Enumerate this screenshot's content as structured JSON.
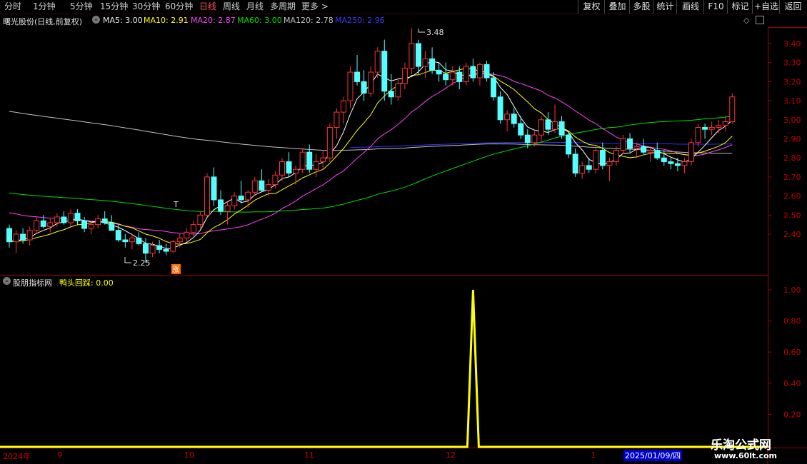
{
  "toolbar": {
    "periods": [
      "分时",
      "1分钟",
      "5分钟",
      "15分钟",
      "30分钟",
      "60分钟",
      "日线",
      "周线",
      "月线",
      "多周期",
      "更多"
    ],
    "active_period": "日线",
    "right_buttons": [
      "复权",
      "叠加",
      "多股",
      "统计",
      "画线",
      "F10",
      "标记",
      "+自选",
      "返回"
    ]
  },
  "legend": {
    "stock_title": "曙光股份(日线,前复权)",
    "ma5": "MA5: 3.00",
    "ma10": "MA10: 2.91",
    "ma20": "MA20: 2.87",
    "ma60": "MA60: 3.00",
    "ma120": "MA120: 2.78",
    "ma250": "MA250: 2.96"
  },
  "indicator_legend": {
    "name": "股朋指标网",
    "value": "鸭头回踩: 0.00"
  },
  "annotations": {
    "high_label": "3.48",
    "low_label": "2.25",
    "surge_marker": "涨",
    "t_marker": "T"
  },
  "price_axis": [
    "3.40",
    "3.30",
    "3.20",
    "3.10",
    "3.00",
    "2.90",
    "2.80",
    "2.70",
    "2.60",
    "2.50",
    "2.40"
  ],
  "indicator_axis": [
    "1.00",
    "0.80",
    "0.60",
    "0.40",
    "0.20"
  ],
  "dates": {
    "year": "2024年",
    "m9": "9",
    "m10": "10",
    "m11": "11",
    "m12": "12",
    "m1": "1",
    "cursor_date": "2025/01/09/四"
  },
  "watermark": {
    "brand": "乐淘公式网",
    "site": "www.60lt.com"
  },
  "colors": {
    "up": "#ff3333",
    "down": "#54ffff",
    "ma5": "#ffffff",
    "ma10": "#ffff00",
    "ma20": "#ff44ff",
    "ma60": "#00e000",
    "ma120": "#c0c0c0",
    "ma250": "#3030ff",
    "indicator": "#ffff00",
    "axis": "#c00000"
  },
  "chart_data": [
    {
      "type": "candlestick",
      "title": "曙光股份(日线,前复权)",
      "y_range": [
        2.2,
        3.5
      ],
      "high": 3.48,
      "low": 2.25,
      "ohlc": [
        [
          2.43,
          2.45,
          2.33,
          2.36
        ],
        [
          2.36,
          2.42,
          2.3,
          2.4
        ],
        [
          2.4,
          2.43,
          2.35,
          2.37
        ],
        [
          2.37,
          2.44,
          2.34,
          2.42
        ],
        [
          2.42,
          2.49,
          2.4,
          2.47
        ],
        [
          2.47,
          2.5,
          2.43,
          2.44
        ],
        [
          2.44,
          2.48,
          2.41,
          2.46
        ],
        [
          2.46,
          2.51,
          2.44,
          2.49
        ],
        [
          2.49,
          2.52,
          2.45,
          2.46
        ],
        [
          2.46,
          2.53,
          2.44,
          2.51
        ],
        [
          2.51,
          2.53,
          2.45,
          2.47
        ],
        [
          2.47,
          2.49,
          2.41,
          2.43
        ],
        [
          2.43,
          2.47,
          2.4,
          2.45
        ],
        [
          2.45,
          2.5,
          2.43,
          2.48
        ],
        [
          2.48,
          2.52,
          2.45,
          2.46
        ],
        [
          2.46,
          2.5,
          2.42,
          2.42
        ],
        [
          2.42,
          2.45,
          2.36,
          2.37
        ],
        [
          2.37,
          2.4,
          2.33,
          2.36
        ],
        [
          2.36,
          2.4,
          2.32,
          2.38
        ],
        [
          2.38,
          2.41,
          2.34,
          2.35
        ],
        [
          2.35,
          2.38,
          2.25,
          2.3
        ],
        [
          2.3,
          2.36,
          2.28,
          2.34
        ],
        [
          2.34,
          2.37,
          2.3,
          2.32
        ],
        [
          2.32,
          2.35,
          2.29,
          2.31
        ],
        [
          2.31,
          2.37,
          2.3,
          2.36
        ],
        [
          2.36,
          2.4,
          2.33,
          2.38
        ],
        [
          2.38,
          2.43,
          2.36,
          2.41
        ],
        [
          2.41,
          2.47,
          2.39,
          2.45
        ],
        [
          2.45,
          2.52,
          2.43,
          2.5
        ],
        [
          2.5,
          2.72,
          2.49,
          2.7
        ],
        [
          2.7,
          2.75,
          2.55,
          2.58
        ],
        [
          2.58,
          2.63,
          2.5,
          2.52
        ],
        [
          2.52,
          2.57,
          2.45,
          2.55
        ],
        [
          2.55,
          2.62,
          2.53,
          2.6
        ],
        [
          2.6,
          2.68,
          2.56,
          2.58
        ],
        [
          2.58,
          2.63,
          2.54,
          2.62
        ],
        [
          2.62,
          2.7,
          2.6,
          2.68
        ],
        [
          2.68,
          2.74,
          2.62,
          2.63
        ],
        [
          2.63,
          2.69,
          2.6,
          2.66
        ],
        [
          2.66,
          2.73,
          2.64,
          2.71
        ],
        [
          2.71,
          2.8,
          2.68,
          2.78
        ],
        [
          2.78,
          2.83,
          2.7,
          2.72
        ],
        [
          2.72,
          2.76,
          2.66,
          2.74
        ],
        [
          2.74,
          2.85,
          2.72,
          2.83
        ],
        [
          2.83,
          2.87,
          2.72,
          2.74
        ],
        [
          2.74,
          2.82,
          2.7,
          2.78
        ],
        [
          2.78,
          2.84,
          2.74,
          2.8
        ],
        [
          2.8,
          2.98,
          2.78,
          2.96
        ],
        [
          2.96,
          3.06,
          2.9,
          3.04
        ],
        [
          3.04,
          3.12,
          2.98,
          3.1
        ],
        [
          3.1,
          3.28,
          3.06,
          3.25
        ],
        [
          3.25,
          3.34,
          3.18,
          3.2
        ],
        [
          3.2,
          3.26,
          3.1,
          3.14
        ],
        [
          3.14,
          3.28,
          3.12,
          3.25
        ],
        [
          3.25,
          3.38,
          3.22,
          3.36
        ],
        [
          3.36,
          3.42,
          3.1,
          3.15
        ],
        [
          3.15,
          3.24,
          3.08,
          3.12
        ],
        [
          3.12,
          3.22,
          3.1,
          3.19
        ],
        [
          3.19,
          3.3,
          3.16,
          3.27
        ],
        [
          3.27,
          3.48,
          3.24,
          3.4
        ],
        [
          3.4,
          3.42,
          3.24,
          3.28
        ],
        [
          3.28,
          3.36,
          3.22,
          3.32
        ],
        [
          3.32,
          3.38,
          3.24,
          3.26
        ],
        [
          3.26,
          3.3,
          3.2,
          3.24
        ],
        [
          3.24,
          3.3,
          3.18,
          3.21
        ],
        [
          3.21,
          3.28,
          3.18,
          3.25
        ],
        [
          3.25,
          3.28,
          3.16,
          3.2
        ],
        [
          3.2,
          3.3,
          3.18,
          3.28
        ],
        [
          3.28,
          3.32,
          3.2,
          3.22
        ],
        [
          3.22,
          3.3,
          3.18,
          3.29
        ],
        [
          3.29,
          3.31,
          3.2,
          3.22
        ],
        [
          3.22,
          3.25,
          3.1,
          3.12
        ],
        [
          3.12,
          3.15,
          2.98,
          3.0
        ],
        [
          3.0,
          3.05,
          2.94,
          3.03
        ],
        [
          3.03,
          3.06,
          2.96,
          2.98
        ],
        [
          2.98,
          3.02,
          2.9,
          2.92
        ],
        [
          2.92,
          2.95,
          2.85,
          2.88
        ],
        [
          2.88,
          2.94,
          2.86,
          2.92
        ],
        [
          2.92,
          3.02,
          2.88,
          3.0
        ],
        [
          3.0,
          3.04,
          2.92,
          2.95
        ],
        [
          2.95,
          3.08,
          2.93,
          2.99
        ],
        [
          2.99,
          3.02,
          2.9,
          2.92
        ],
        [
          2.92,
          2.94,
          2.8,
          2.82
        ],
        [
          2.82,
          2.85,
          2.7,
          2.72
        ],
        [
          2.72,
          2.78,
          2.69,
          2.76
        ],
        [
          2.76,
          2.8,
          2.72,
          2.74
        ],
        [
          2.74,
          2.86,
          2.72,
          2.84
        ],
        [
          2.84,
          2.88,
          2.74,
          2.76
        ],
        [
          2.76,
          2.8,
          2.68,
          2.78
        ],
        [
          2.78,
          2.86,
          2.76,
          2.84
        ],
        [
          2.84,
          2.92,
          2.82,
          2.9
        ],
        [
          2.9,
          2.93,
          2.83,
          2.85
        ],
        [
          2.85,
          2.88,
          2.8,
          2.86
        ],
        [
          2.86,
          2.9,
          2.82,
          2.83
        ],
        [
          2.83,
          2.86,
          2.78,
          2.84
        ],
        [
          2.84,
          2.88,
          2.79,
          2.8
        ],
        [
          2.8,
          2.84,
          2.76,
          2.78
        ],
        [
          2.78,
          2.8,
          2.74,
          2.77
        ],
        [
          2.77,
          2.8,
          2.73,
          2.76
        ],
        [
          2.76,
          2.8,
          2.72,
          2.78
        ],
        [
          2.78,
          2.9,
          2.76,
          2.88
        ],
        [
          2.88,
          2.98,
          2.86,
          2.96
        ],
        [
          2.96,
          2.98,
          2.9,
          2.95
        ],
        [
          2.95,
          2.99,
          2.92,
          2.96
        ],
        [
          2.96,
          3.0,
          2.93,
          2.97
        ],
        [
          2.97,
          3.02,
          2.94,
          2.99
        ],
        [
          2.99,
          3.14,
          2.98,
          3.12
        ]
      ]
    },
    {
      "type": "line",
      "title": "股朋指标网",
      "series": [
        {
          "name": "鸭头回踩",
          "spike_index": 68,
          "spike_value": 1.0,
          "baseline": 0.0,
          "current": 0.0
        }
      ],
      "y_range": [
        0,
        1.0
      ]
    }
  ]
}
